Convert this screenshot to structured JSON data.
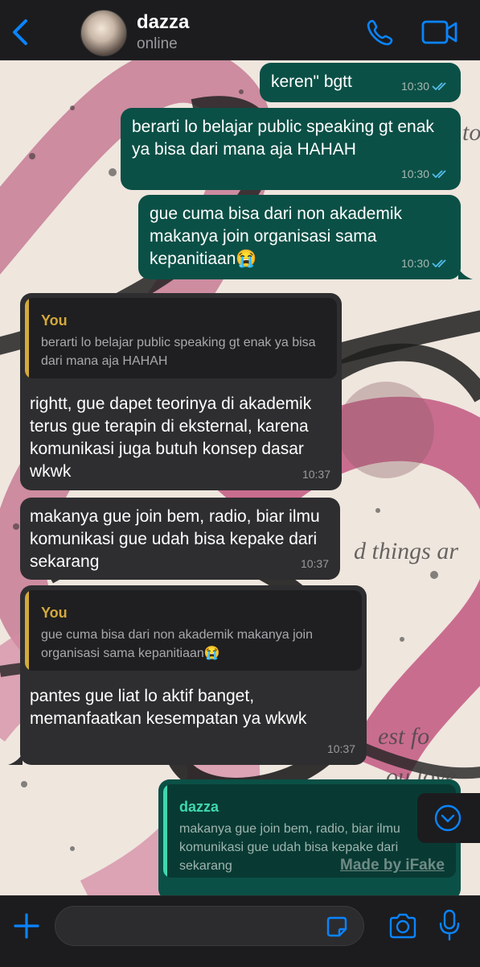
{
  "header": {
    "contact_name": "dazza",
    "contact_status": "online"
  },
  "messages": [
    {
      "direction": "out",
      "text": "keren\" bgtt",
      "time": "10:30",
      "read": true
    },
    {
      "direction": "out",
      "text": "berarti lo belajar public speaking gt enak ya bisa dari mana aja HAHAH",
      "time": "10:30",
      "read": true
    },
    {
      "direction": "out",
      "text": "gue cuma bisa dari non akademik makanya join organisasi sama kepanitiaan😭",
      "time": "10:30",
      "read": true
    },
    {
      "direction": "in",
      "quote_author": "You",
      "quote_text": "berarti lo belajar public speaking gt enak ya bisa dari mana aja HAHAH",
      "text": "rightt, gue dapet teorinya di akademik terus gue terapin di eksternal, karena komunikasi juga butuh konsep dasar wkwk",
      "time": "10:37"
    },
    {
      "direction": "in",
      "text": "makanya gue join bem, radio, biar ilmu komunikasi gue udah bisa kepake dari sekarang",
      "time": "10:37"
    },
    {
      "direction": "in",
      "quote_author": "You",
      "quote_text": "gue cuma bisa dari non akademik makanya join organisasi sama kepanitiaan😭",
      "text": "pantes gue liat lo aktif banget, memanfaatkan kesempatan ya wkwk",
      "time": "10:37"
    },
    {
      "direction": "out",
      "quote_author": "dazza",
      "quote_text": "makanya gue join bem, radio, biar ilmu komunikasi gue udah bisa kepake dari sekarang",
      "text": "",
      "time": ""
    }
  ],
  "watermark": "Made by iFake",
  "composer": {
    "value": "",
    "placeholder": ""
  },
  "colors": {
    "accent": "#0a84ff",
    "outgoing_bubble": "#0b5046",
    "incoming_bubble": "#2e2e30",
    "quote_you": "#d4a93c",
    "quote_dazza": "#3fd8ad",
    "read_ticks": "#53bdeb"
  }
}
